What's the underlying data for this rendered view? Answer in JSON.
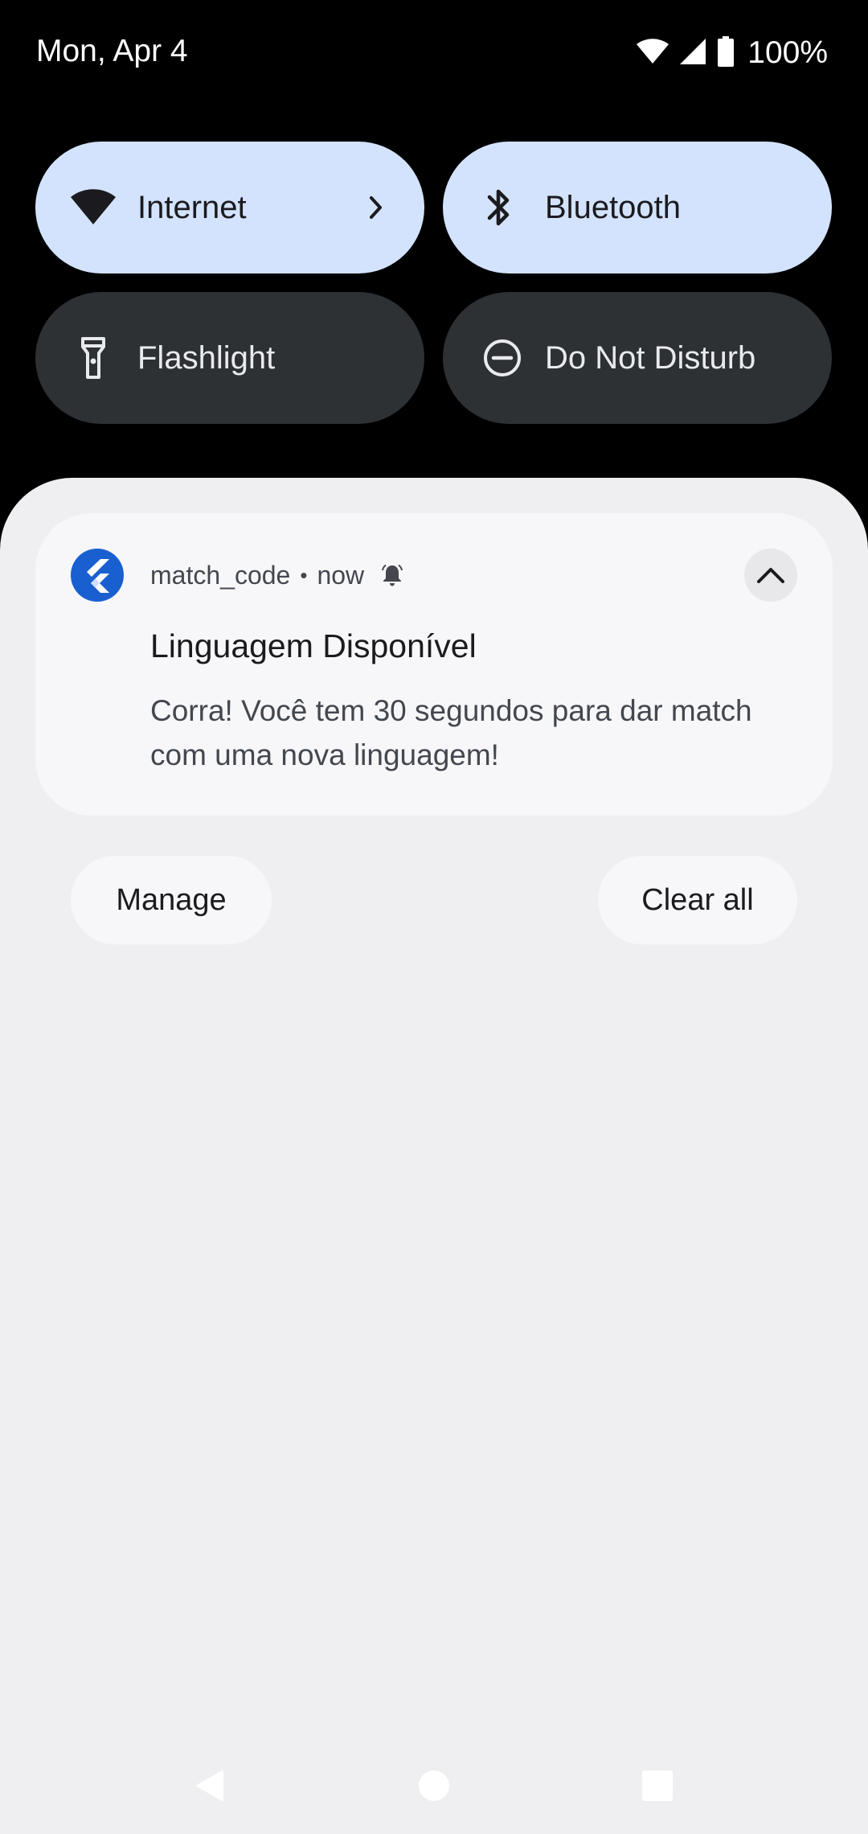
{
  "status_bar": {
    "date": "Mon, Apr 4",
    "battery": "100%",
    "icons": [
      "wifi-icon",
      "cell-signal-icon",
      "battery-icon"
    ]
  },
  "quick_settings": {
    "tiles": [
      {
        "label": "Internet",
        "icon": "wifi-icon",
        "state": "on",
        "has_chevron": true
      },
      {
        "label": "Bluetooth",
        "icon": "bluetooth-icon",
        "state": "on"
      },
      {
        "label": "Flashlight",
        "icon": "flashlight-icon",
        "state": "off"
      },
      {
        "label": "Do Not Disturb",
        "icon": "do-not-disturb-icon",
        "state": "off"
      }
    ]
  },
  "notification": {
    "app_name": "match_code",
    "separator": "•",
    "time": "now",
    "title": "Linguagem Disponível",
    "body": "Corra! Você tem 30 segundos para dar match com uma nova linguagem!",
    "app_icon": "flutter-logo-icon",
    "alert_icon": "bell-icon",
    "expand_icon": "chevron-up-icon"
  },
  "actions": {
    "manage": "Manage",
    "clear_all": "Clear all"
  },
  "nav": {
    "buttons": [
      "back-icon",
      "home-icon",
      "recents-icon"
    ]
  },
  "colors": {
    "tile_on": "#d3e3fd",
    "tile_off": "#2e3134",
    "shade": "#efeff2",
    "card": "#f7f7fa",
    "app_icon": "#1a5fd0"
  }
}
